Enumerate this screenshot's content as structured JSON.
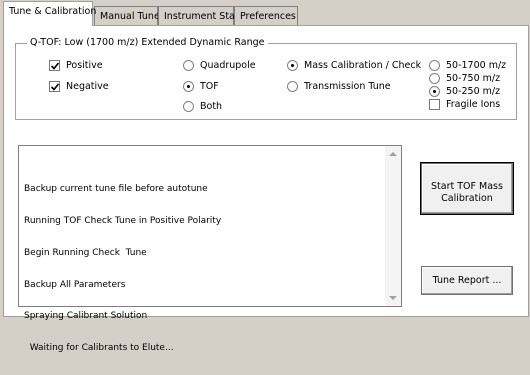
{
  "tabs": [
    {
      "label": "Tune & Calibration",
      "active": true
    },
    {
      "label": "Manual Tune",
      "active": false
    },
    {
      "label": "Instrument State",
      "active": false
    },
    {
      "label": "Preferences",
      "active": false
    }
  ],
  "group": {
    "title": "Q-TOF:  Low (1700 m/z) Extended Dynamic Range",
    "polarity": [
      {
        "label": "Positive",
        "checked": true
      },
      {
        "label": "Negative",
        "checked": true
      }
    ],
    "analyzer": [
      {
        "label": "Quadrupole",
        "selected": false
      },
      {
        "label": "TOF",
        "selected": true
      },
      {
        "label": "Both",
        "selected": false
      }
    ],
    "mode": [
      {
        "label": "Mass Calibration / Check",
        "selected": true
      },
      {
        "label": "Transmission Tune",
        "selected": false
      }
    ],
    "range": [
      {
        "label": "50-1700 m/z",
        "selected": false
      },
      {
        "label": "50-750 m/z",
        "selected": false
      },
      {
        "label": "50-250 m/z",
        "selected": true
      }
    ],
    "fragile": {
      "label": "Fragile Ions",
      "checked": false
    }
  },
  "log": {
    "lines": [
      "Backup current tune file before autotune",
      "Running TOF Check Tune in Positive Polarity",
      "Begin Running Check  Tune",
      "Backup All Parameters",
      "Spraying Calibrant Solution",
      "  Waiting for Calibrants to Elute..."
    ]
  },
  "buttons": {
    "start_line1": "Start TOF Mass",
    "start_line2": "Calibration",
    "report": "Tune Report ..."
  }
}
